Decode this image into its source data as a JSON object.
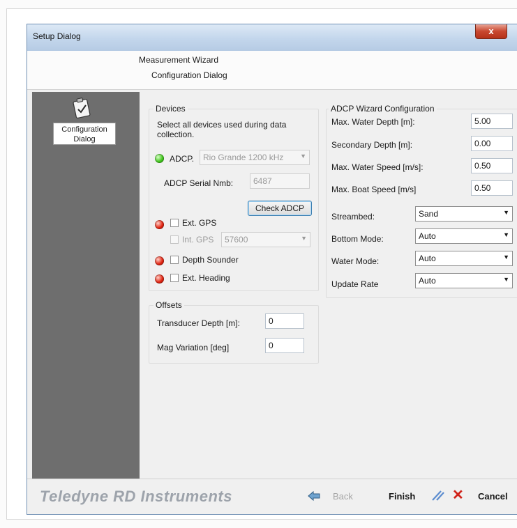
{
  "window": {
    "title": "Setup Dialog",
    "close_label": "x"
  },
  "header": {
    "wizard": "Measurement Wizard",
    "step": "Configuration Dialog"
  },
  "sidebar": {
    "items": [
      {
        "label": "Configuration Dialog",
        "icon": "clipboard-check-icon"
      }
    ]
  },
  "devices": {
    "title": "Devices",
    "instruction": "Select all devices used during data collection.",
    "adcp_label": "ADCP.",
    "adcp_model": "Rio Grande 1200 kHz",
    "serial_label": "ADCP Serial Nmb:",
    "serial_value": "6487",
    "check_button": "Check ADCP",
    "ext_gps_label": "Ext. GPS",
    "int_gps_label": "Int. GPS",
    "int_gps_baud": "57600",
    "depth_sounder_label": "Depth Sounder",
    "ext_heading_label": "Ext. Heading",
    "status_colors": {
      "connected": "#40c41c",
      "not_connected": "#e0220f"
    }
  },
  "offsets": {
    "title": "Offsets",
    "transducer_label": "Transducer Depth [m]:",
    "transducer_value": "0",
    "mag_label": "Mag Variation [deg]",
    "mag_value": "0"
  },
  "config": {
    "title": "ADCP Wizard Configuration",
    "fields": [
      {
        "label": "Max. Water Depth [m]:",
        "value": "5.00"
      },
      {
        "label": "Secondary Depth [m]:",
        "value": "0.00"
      },
      {
        "label": "Max. Water Speed [m/s]:",
        "value": "0.50"
      },
      {
        "label": "Max. Boat Speed [m/s]",
        "value": "0.50"
      }
    ],
    "selects": [
      {
        "label": "Streambed:",
        "value": "Sand"
      },
      {
        "label": "Bottom Mode:",
        "value": "Auto"
      },
      {
        "label": "Water Mode:",
        "value": "Auto"
      },
      {
        "label": "Update Rate",
        "value": "Auto"
      }
    ]
  },
  "footer": {
    "brand": "Teledyne RD Instruments",
    "back": "Back",
    "finish": "Finish",
    "cancel": "Cancel"
  }
}
